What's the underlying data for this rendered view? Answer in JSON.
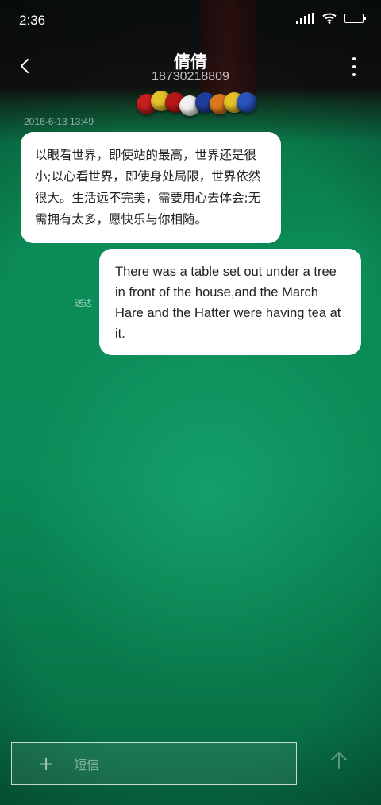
{
  "status_bar": {
    "time": "2:36",
    "signal_icon": "cellular-signal-icon",
    "wifi_icon": "wifi-icon",
    "battery_icon": "battery-icon",
    "battery_level": 0.9
  },
  "header": {
    "back_icon": "chevron-left-icon",
    "contact_name": "倩倩",
    "phone_number": "18730218809",
    "more_icon": "more-vertical-icon"
  },
  "conversation": {
    "timestamp": "2016-6-13 13:49",
    "messages": [
      {
        "direction": "incoming",
        "text": "以眼看世界，即使站的最高，世界还是很小;以心看世界，即使身处局限，世界依然很大。生活远不完美，需要用心去体会;无需拥有太多，愿快乐与你相随。"
      },
      {
        "direction": "outgoing",
        "text": "There was a table set out under a tree in front of the house,and the March Hare and the Hatter were having tea at it.",
        "status": "送达"
      }
    ]
  },
  "composer": {
    "add_icon": "plus-icon",
    "add_label": "+",
    "placeholder": "短信",
    "value": "",
    "send_icon": "arrow-up-icon"
  },
  "colors": {
    "background": "#0b8c58",
    "bubble": "#ffffff",
    "bubble_text": "#222222"
  }
}
